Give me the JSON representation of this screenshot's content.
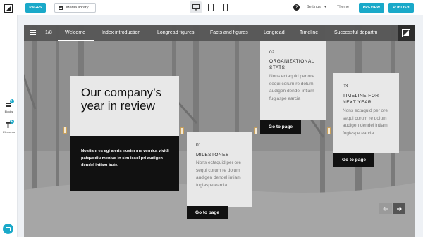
{
  "toolbar": {
    "pages_label": "PAGES",
    "media_label": "Media library",
    "settings_label": "Settings",
    "theme_label": "Theme",
    "preview_label": "PREVIEW",
    "publish_label": "PUBLISH",
    "accent_color": "#1aa9c9",
    "icons": [
      "image-icon",
      "desktop-icon",
      "tablet-icon",
      "mobile-icon",
      "help-icon",
      "chevron-down-icon"
    ]
  },
  "leftrail": {
    "blocks_label": "Blocks",
    "elements_label": "Elements",
    "icons": [
      "blocks-add-icon",
      "elements-add-icon",
      "chat-icon"
    ]
  },
  "story": {
    "page_counter": "1/8",
    "nav_items": [
      "Welcome",
      "Index introduction",
      "Longread figures",
      "Facts and figures",
      "Longread",
      "Timeline",
      "Successful departm"
    ],
    "active_nav": "Welcome",
    "hero": {
      "title": "Our company’s year in review",
      "description": "Nostiam es egi aleris noxim me vernica vividi patquodiu menius in sim issol pri audigen dendel intiam bute."
    },
    "cards": [
      {
        "number": "01",
        "title": "MILESTONES",
        "body": "Nons ectaquid per ore sequi corum re dolum audigen dendel intiam fugiaspe earcia",
        "button": "Go to page"
      },
      {
        "number": "02",
        "title": "ORGANIZATIONAL STATS",
        "body": "Nons ectaquid per ore sequi corum re dolum audigen dendel intiam fugiaspe earcia",
        "button": "Go to page"
      },
      {
        "number": "03",
        "title": "TIMELINE FOR NEXT YEAR",
        "body": "Nons ectaquid per ore sequi corum re dolum audigen dendel intiam fugiaspe earcia",
        "button": "Go to page"
      }
    ]
  }
}
